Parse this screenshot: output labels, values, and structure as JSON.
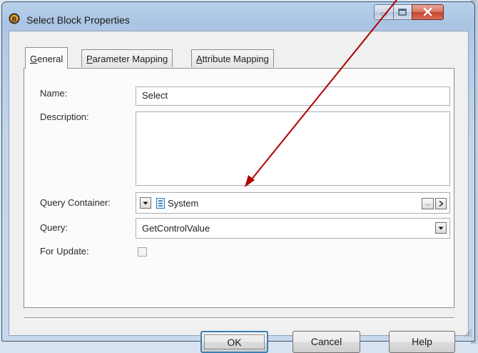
{
  "window": {
    "title": "Select Block Properties",
    "icon": "app-b-icon"
  },
  "tabs": [
    {
      "label": "General",
      "accel": "G",
      "rest": "eneral",
      "active": true
    },
    {
      "label": "Parameter Mapping",
      "accel": "P",
      "rest": "arameter Mapping",
      "active": false
    },
    {
      "label": "Attribute Mapping",
      "accel": "A",
      "rest": "ttribute Mapping",
      "active": false
    }
  ],
  "form": {
    "name_label": "Name:",
    "name_value": "Select",
    "description_label": "Description:",
    "description_value": "",
    "query_container_label": "Query Container:",
    "query_container_value": "System",
    "query_label": "Query:",
    "query_value": "GetControlValue",
    "for_update_label": "For Update:",
    "for_update_checked": false
  },
  "buttons": {
    "ok": "OK",
    "cancel": "Cancel",
    "help": "Help"
  },
  "annotation": {
    "arrow_color": "#b00000"
  }
}
